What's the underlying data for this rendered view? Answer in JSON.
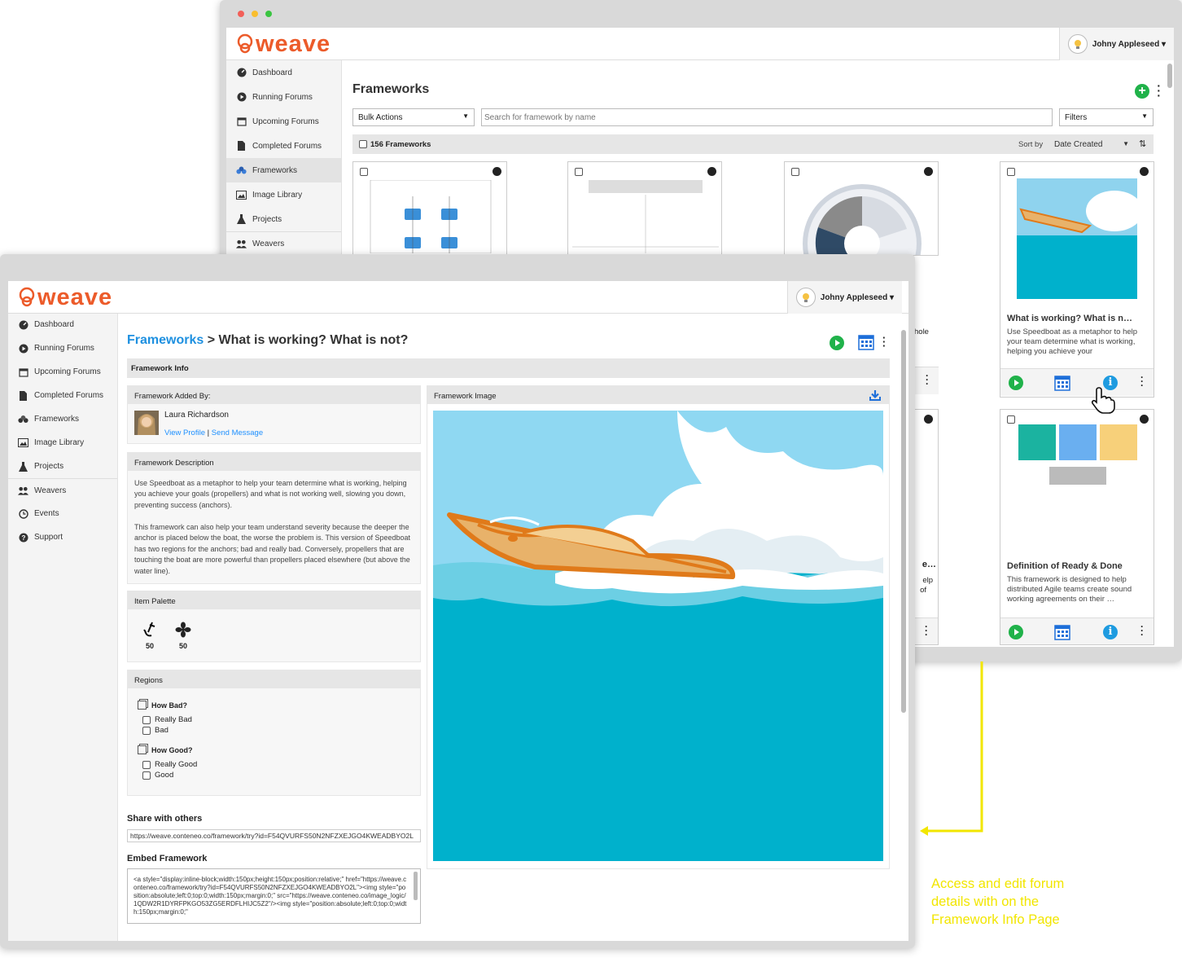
{
  "brand": {
    "name": "weave",
    "color": "#ec5b2a"
  },
  "user": {
    "name": "Johny Appleseed ▾"
  },
  "nav_back": [
    {
      "label": "Dashboard",
      "icon": "dashboard-icon"
    },
    {
      "label": "Running Forums",
      "icon": "play-circle-icon"
    },
    {
      "label": "Upcoming Forums",
      "icon": "calendar-icon"
    },
    {
      "label": "Completed Forums",
      "icon": "document-icon"
    },
    {
      "label": "Frameworks",
      "icon": "frameworks-icon"
    },
    {
      "label": "Image Library",
      "icon": "image-icon"
    },
    {
      "label": "Projects",
      "icon": "flask-icon"
    },
    {
      "label": "Weavers",
      "icon": "users-icon"
    }
  ],
  "nav_front": [
    {
      "label": "Dashboard"
    },
    {
      "label": "Running Forums"
    },
    {
      "label": "Upcoming Forums"
    },
    {
      "label": "Completed Forums"
    },
    {
      "label": "Frameworks"
    },
    {
      "label": "Image Library"
    },
    {
      "label": "Projects"
    },
    {
      "label": "Weavers"
    },
    {
      "label": "Events"
    },
    {
      "label": "Support"
    }
  ],
  "list": {
    "title": "Frameworks",
    "bulk_actions": "Bulk Actions",
    "search_placeholder": "Search for framework by name",
    "filters": "Filters",
    "count_label": "156 Frameworks",
    "sort_by": "Sort by",
    "sort_value": "Date Created",
    "card1": {
      "title": "What is working? What is n…",
      "desc": "Use Speedboat as a metaphor to help your team determine what is working, helping you achieve your"
    },
    "card2": {
      "title": "Definition of Ready & Done",
      "desc": "This framework is designed to help distributed Agile teams create sound working agreements on their …"
    },
    "peek": {
      "a": "hole",
      "b": "e…",
      "c": "elp",
      "d": "of"
    }
  },
  "detail": {
    "breadcrumb_link": "Frameworks",
    "breadcrumb_sep": " > ",
    "title": "What is working? What is not?",
    "info_header": "Framework Info",
    "added_by_header": "Framework Added By:",
    "author": "Laura Richardson",
    "view_profile": "View Profile",
    "link_sep": " | ",
    "send_message": "Send Message",
    "desc_header": "Framework Description",
    "desc_p1": "Use Speedboat as a metaphor to help your team determine what is working, helping you achieve your goals (propellers) and what is not working well, slowing you down, preventing success (anchors).",
    "desc_p2": "This framework can also help your team understand severity because the deeper the anchor is placed below the boat, the worse the problem is. This version of Speedboat has two regions for the anchors; bad and really bad. Conversely, propellers that are touching the boat are more powerful than propellers placed elsewhere (but above the water line).",
    "palette_header": "Item Palette",
    "palette": [
      {
        "icon": "anchor-icon",
        "count": "50"
      },
      {
        "icon": "propeller-icon",
        "count": "50"
      }
    ],
    "regions_header": "Regions",
    "regions": [
      {
        "group": "How Bad?",
        "items": [
          "Really Bad",
          "Bad"
        ]
      },
      {
        "group": "How Good?",
        "items": [
          "Really Good",
          "Good"
        ]
      }
    ],
    "share_header": "Share with others",
    "share_url": "https://weave.conteneo.co/framework/try?id=F54QVURFS50N2NFZXEJGO4KWEADBYO2L",
    "embed_header": "Embed Framework",
    "embed_code": "<a style=\"display:inline-block;width:150px;height:150px;position:relative;\" href=\"https://weave.conteneo.co/framework/try?id=F54QVURFS50N2NFZXEJGO4KWEADBYO2L\"><img style=\"position:absolute;left:0;top:0;width:150px;margin:0;\" src=\"https://weave.conteneo.co/image_logic/1QDW2R1DYRFPKGO53ZG5ERDFLHIJC5Z2\"/><img style=\"position:absolute;left:0;top:0;width:150px;margin:0;\"",
    "image_header": "Framework Image"
  },
  "annotation": {
    "text": "Access and edit forum details with on the Framework Info Page",
    "color": "#f2e600"
  }
}
